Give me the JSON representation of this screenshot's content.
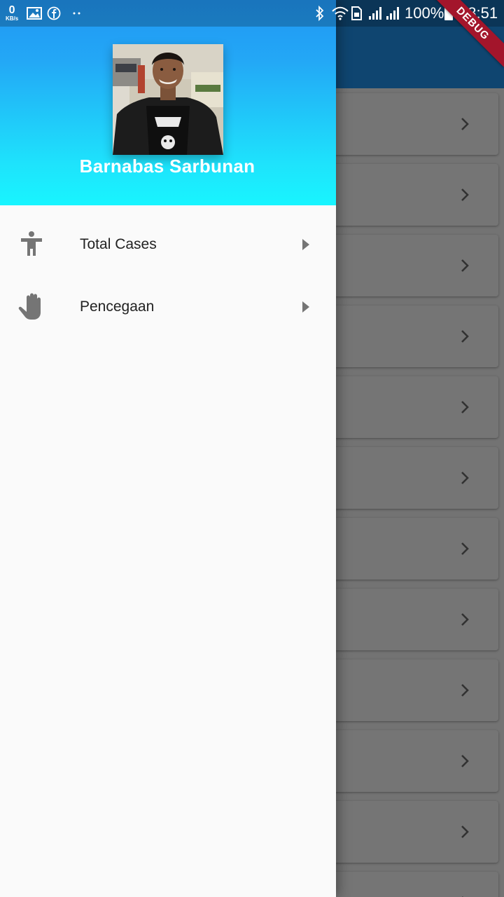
{
  "status_bar": {
    "network_speed_value": "0",
    "network_speed_unit": "KB/s",
    "battery_percent": "100%",
    "time": "18:51",
    "left_icons": [
      "gallery-icon",
      "facebook-icon",
      "more-dots-icon"
    ],
    "right_icons": [
      "bluetooth-icon",
      "wifi-icon",
      "sim-icon",
      "signal-icon",
      "signal-icon",
      "battery-icon"
    ]
  },
  "debug_banner": {
    "label": "DEBUG"
  },
  "drawer": {
    "header": {
      "user_name": "Barnabas Sarbunan",
      "gradient_top": "#2196f3",
      "gradient_bottom": "#18f5ff"
    },
    "items": [
      {
        "label": "Total Cases",
        "icon": "accessibility-icon"
      },
      {
        "label": "Pencegaan",
        "icon": "hand-icon"
      }
    ]
  },
  "background": {
    "app_bar_color": "#2196f3",
    "list_rows": 12,
    "row_icon": "chevron-right-icon"
  },
  "colors": {
    "accent": "#2196f3",
    "debug_banner": "#a3152b",
    "icon_gray": "#757575"
  }
}
